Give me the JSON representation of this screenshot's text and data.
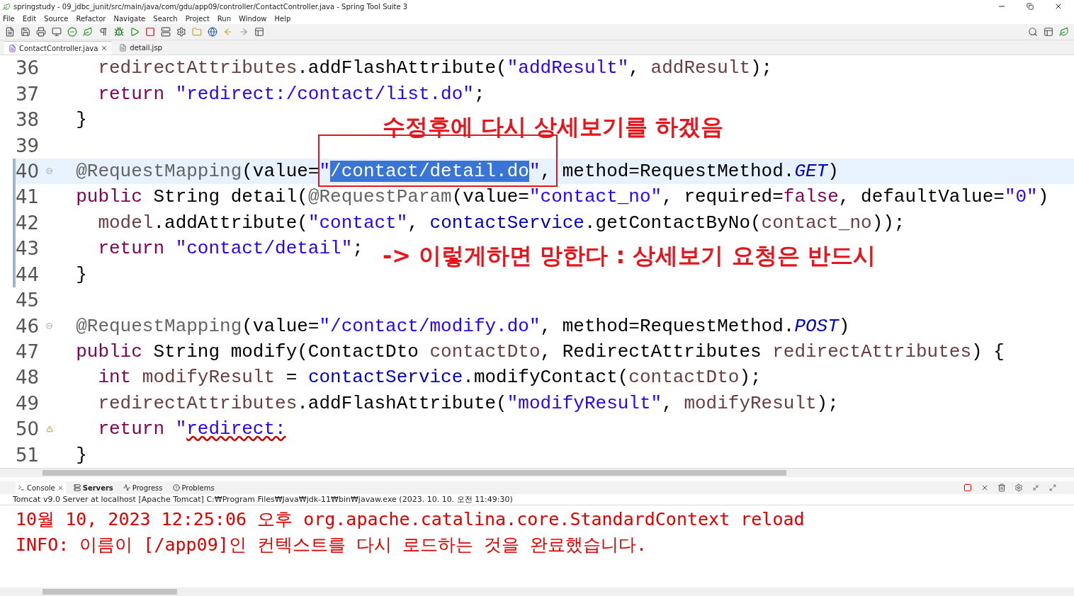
{
  "window": {
    "title": "springstudy - 09_jdbc_junit/src/main/java/com/gdu/app09/controller/ContactController.java - Spring Tool Suite 3"
  },
  "menu": [
    "File",
    "Edit",
    "Source",
    "Refactor",
    "Navigate",
    "Search",
    "Project",
    "Run",
    "Window",
    "Help"
  ],
  "editor_tabs": [
    {
      "label": "ContactController.java",
      "selected": true,
      "kind": "java"
    },
    {
      "label": "detail.jsp",
      "selected": false,
      "kind": "jsp"
    }
  ],
  "code_lines": [
    {
      "number": "36",
      "current": false,
      "changed": false,
      "fold": false,
      "warning": false,
      "tokens": [
        {
          "kind": "var",
          "text": "    redirectAttributes"
        },
        {
          "kind": "plain",
          "text": ".addFlashAttribute("
        },
        {
          "kind": "string",
          "text": "\"addResult\""
        },
        {
          "kind": "plain",
          "text": ", "
        },
        {
          "kind": "var",
          "text": "addResult"
        },
        {
          "kind": "plain",
          "text": ");"
        }
      ]
    },
    {
      "number": "37",
      "current": false,
      "changed": false,
      "fold": false,
      "warning": false,
      "tokens": [
        {
          "kind": "keyword",
          "text": "    return "
        },
        {
          "kind": "string",
          "text": "\"redirect:/contact/list.do\""
        },
        {
          "kind": "plain",
          "text": ";"
        }
      ]
    },
    {
      "number": "38",
      "current": false,
      "changed": false,
      "fold": false,
      "warning": false,
      "tokens": [
        {
          "kind": "plain",
          "text": "  }"
        }
      ]
    },
    {
      "number": "39",
      "current": false,
      "changed": false,
      "fold": false,
      "warning": false
    },
    {
      "number": "40",
      "current": true,
      "changed": true,
      "fold": true,
      "warning": false,
      "tokens": [
        {
          "kind": "annotation",
          "text": "  @RequestMapping"
        },
        {
          "kind": "plain",
          "text": "(value="
        },
        {
          "kind": "string",
          "text": "\""
        },
        {
          "kind": "selected",
          "text": "/contact/detail.do"
        },
        {
          "kind": "string",
          "text": "\""
        },
        {
          "kind": "plain",
          "text": ", method=RequestMethod."
        },
        {
          "kind": "const",
          "text": "GET"
        },
        {
          "kind": "plain",
          "text": ")"
        }
      ]
    },
    {
      "number": "41",
      "current": false,
      "changed": true,
      "fold": false,
      "warning": false,
      "tokens": [
        {
          "kind": "keyword",
          "text": "  public"
        },
        {
          "kind": "plain",
          "text": " String detail("
        },
        {
          "kind": "annotation",
          "text": "@RequestParam"
        },
        {
          "kind": "plain",
          "text": "(value="
        },
        {
          "kind": "string",
          "text": "\"contact_no\""
        },
        {
          "kind": "plain",
          "text": ", required="
        },
        {
          "kind": "keyword",
          "text": "false"
        },
        {
          "kind": "plain",
          "text": ", defaultValue="
        },
        {
          "kind": "string",
          "text": "\"0\""
        },
        {
          "kind": "plain",
          "text": ")"
        }
      ]
    },
    {
      "number": "42",
      "current": false,
      "changed": true,
      "fold": false,
      "warning": false,
      "tokens": [
        {
          "kind": "var",
          "text": "    model"
        },
        {
          "kind": "plain",
          "text": ".addAttribute("
        },
        {
          "kind": "string",
          "text": "\"contact\""
        },
        {
          "kind": "plain",
          "text": ", "
        },
        {
          "kind": "field",
          "text": "contactService"
        },
        {
          "kind": "plain",
          "text": ".getContactByNo("
        },
        {
          "kind": "var",
          "text": "contact_no"
        },
        {
          "kind": "plain",
          "text": "));"
        }
      ]
    },
    {
      "number": "43",
      "current": false,
      "changed": true,
      "fold": false,
      "warning": false,
      "tokens": [
        {
          "kind": "keyword",
          "text": "    return "
        },
        {
          "kind": "string",
          "text": "\"contact/detail\""
        },
        {
          "kind": "plain",
          "text": ";"
        }
      ]
    },
    {
      "number": "44",
      "current": false,
      "changed": true,
      "fold": false,
      "warning": false,
      "tokens": [
        {
          "kind": "plain",
          "text": "  }"
        }
      ]
    },
    {
      "number": "45",
      "current": false,
      "changed": false,
      "fold": false,
      "warning": false
    },
    {
      "number": "46",
      "current": false,
      "changed": false,
      "fold": true,
      "warning": false,
      "tokens": [
        {
          "kind": "annotation",
          "text": "  @RequestMapping"
        },
        {
          "kind": "plain",
          "text": "(value="
        },
        {
          "kind": "string",
          "text": "\"/contact/modify.do\""
        },
        {
          "kind": "plain",
          "text": ", method=RequestMethod."
        },
        {
          "kind": "const",
          "text": "POST"
        },
        {
          "kind": "plain",
          "text": ")"
        }
      ]
    },
    {
      "number": "47",
      "current": false,
      "changed": false,
      "fold": false,
      "warning": false,
      "tokens": [
        {
          "kind": "keyword",
          "text": "  public"
        },
        {
          "kind": "plain",
          "text": " String modify(ContactDto "
        },
        {
          "kind": "var",
          "text": "contactDto"
        },
        {
          "kind": "plain",
          "text": ", RedirectAttributes "
        },
        {
          "kind": "var",
          "text": "redirectAttributes"
        },
        {
          "kind": "plain",
          "text": ") {"
        }
      ]
    },
    {
      "number": "48",
      "current": false,
      "changed": false,
      "fold": false,
      "warning": false,
      "tokens": [
        {
          "kind": "keyword",
          "text": "    int "
        },
        {
          "kind": "var",
          "text": "modifyResult"
        },
        {
          "kind": "plain",
          "text": " = "
        },
        {
          "kind": "field",
          "text": "contactService"
        },
        {
          "kind": "plain",
          "text": ".modifyContact("
        },
        {
          "kind": "var",
          "text": "contactDto"
        },
        {
          "kind": "plain",
          "text": ");"
        }
      ]
    },
    {
      "number": "49",
      "current": false,
      "changed": false,
      "fold": false,
      "warning": false,
      "tokens": [
        {
          "kind": "var",
          "text": "    redirectAttributes"
        },
        {
          "kind": "plain",
          "text": ".addFlashAttribute("
        },
        {
          "kind": "string",
          "text": "\"modifyResult\""
        },
        {
          "kind": "plain",
          "text": ", "
        },
        {
          "kind": "var",
          "text": "modifyResult"
        },
        {
          "kind": "plain",
          "text": ");"
        }
      ]
    },
    {
      "number": "50",
      "current": false,
      "changed": false,
      "fold": false,
      "warning": true,
      "tokens": [
        {
          "kind": "keyword",
          "text": "    return "
        },
        {
          "kind": "string",
          "text": "\""
        },
        {
          "kind": "error",
          "text": "redirect:"
        }
      ]
    },
    {
      "number": "51",
      "current": false,
      "changed": false,
      "fold": false,
      "warning": false,
      "tokens": [
        {
          "kind": "plain",
          "text": "  }"
        }
      ]
    }
  ],
  "annotations": [
    "수정후에 다시 상세보기를 하겠음",
    "-> 이렇게하면 망한다 : 상세보기 요청은 반드시"
  ],
  "panel_tabs": [
    {
      "label": "Console",
      "selected": true,
      "changed": false
    },
    {
      "label": "Servers",
      "selected": false,
      "changed": true
    },
    {
      "label": "Progress",
      "selected": false,
      "changed": false
    },
    {
      "label": "Problems",
      "selected": false,
      "changed": false
    }
  ],
  "console": {
    "description": "Tomcat v9.0 Server at localhost [Apache Tomcat] C:₩Program Files₩Java₩jdk-11₩bin₩javaw.exe  (2023. 10. 10. 오전 11:49:30)",
    "lines": [
      "10월 10, 2023 12:25:06 오후 org.apache.catalina.core.StandardContext reload",
      "INFO: 이름이 [/app09]인 컨텍스트를 다시 로드하는 것을 완료했습니다."
    ]
  }
}
